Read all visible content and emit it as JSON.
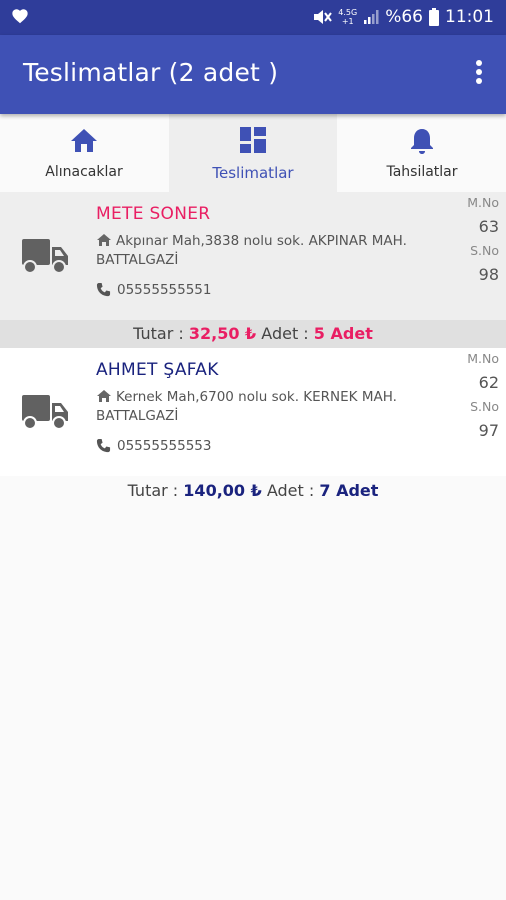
{
  "status_bar": {
    "network_top": "4.5G",
    "network_bottom": "+1",
    "battery_percent": "%66",
    "time": "11:01",
    "icons": [
      "heart-icon",
      "mute-icon",
      "signal-icon",
      "battery-icon"
    ]
  },
  "app_bar": {
    "title": "Teslimatlar (2 adet )",
    "menu_icon": "more-vert-icon",
    "color": "#3f51b5"
  },
  "tabs": [
    {
      "label": "Alınacaklar",
      "icon": "home-icon",
      "active": false
    },
    {
      "label": "Teslimatlar",
      "icon": "dashboard-icon",
      "active": true
    },
    {
      "label": "Tahsilatlar",
      "icon": "bell-icon",
      "active": false
    }
  ],
  "deliveries": [
    {
      "name": "METE SONER",
      "name_color": "#e91e63",
      "address": "Akpınar Mah,3838 nolu sok. AKPINAR MAH. BATTALGAZİ",
      "phone": "05555555551",
      "m_no_label": "M.No",
      "m_no": "63",
      "s_no_label": "S.No",
      "s_no": "98",
      "summary": {
        "tutar_label": "Tutar :",
        "amount": "32,50 ₺",
        "adet_label": "Adet :",
        "count": "5 Adet",
        "accent": "#e91e63"
      }
    },
    {
      "name": "AHMET ŞAFAK",
      "name_color": "#1a237e",
      "address": "Kernek Mah,6700 nolu sok. KERNEK MAH. BATTALGAZİ",
      "phone": "05555555553",
      "m_no_label": "M.No",
      "m_no": "62",
      "s_no_label": "S.No",
      "s_no": "97",
      "summary": {
        "tutar_label": "Tutar :",
        "amount": "140,00 ₺",
        "adet_label": "Adet :",
        "count": "7 Adet",
        "accent": "#1a237e"
      }
    }
  ]
}
